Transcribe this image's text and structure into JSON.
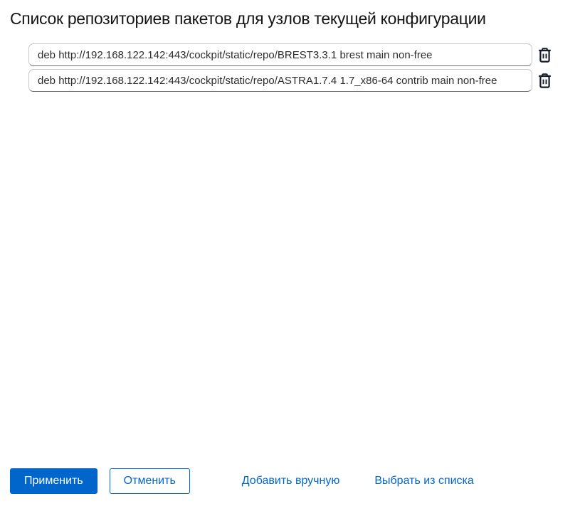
{
  "header": {
    "title": "Список репозиториев пакетов для узлов текущей конфигурации"
  },
  "repos": {
    "items": [
      {
        "value": "deb http://192.168.122.142:443/cockpit/static/repo/BREST3.3.1 brest main non-free"
      },
      {
        "value": "deb http://192.168.122.142:443/cockpit/static/repo/ASTRA1.7.4 1.7_x86-64 contrib main non-free"
      }
    ],
    "delete_icon": "trash-icon"
  },
  "actions": {
    "apply": "Применить",
    "cancel": "Отменить",
    "add_manually": "Добавить вручную",
    "choose_from_list": "Выбрать из списка"
  },
  "colors": {
    "primary_blue": "#0066cc",
    "title_text": "#151515",
    "input_text": "#2d2d2d",
    "input_border": "#c7c7c7",
    "input_border_bottom": "#6a6e73",
    "trash_icon": "#161b28"
  }
}
